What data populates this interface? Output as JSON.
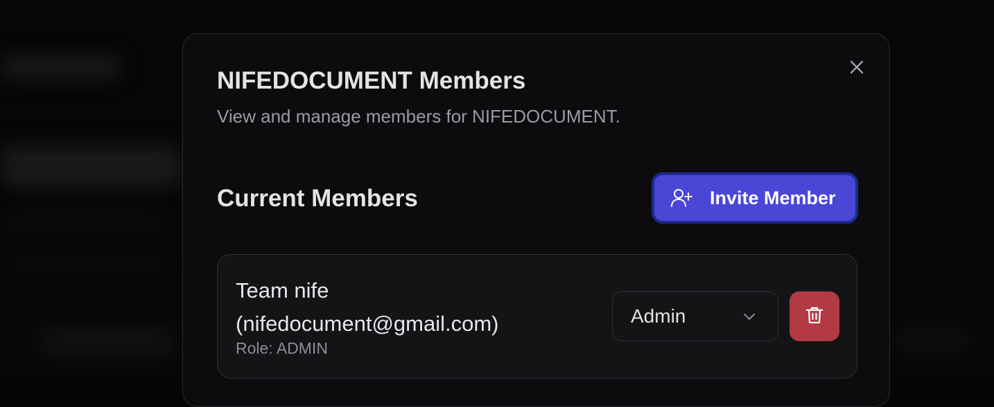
{
  "modal": {
    "title": "NIFEDOCUMENT Members",
    "subtitle": "View and manage members for NIFEDOCUMENT.",
    "close_icon": "close-icon"
  },
  "members_section": {
    "title": "Current Members",
    "invite_button": {
      "label": "Invite Member",
      "icon": "user-plus-icon"
    }
  },
  "members": [
    {
      "name": "Team nife (nifedocument@gmail.com)",
      "role_text": "Role: ADMIN",
      "role_selected": "Admin",
      "delete_icon": "trash-icon"
    }
  ],
  "colors": {
    "accent": "#4a46d6",
    "danger": "#b13a44",
    "background": "#0c0c0e"
  }
}
